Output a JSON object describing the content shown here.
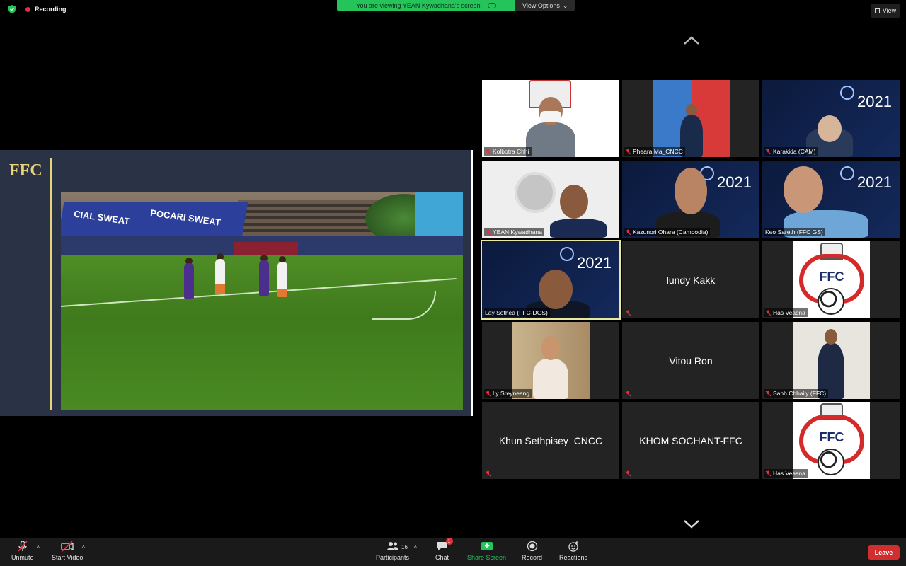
{
  "top": {
    "recording_label": "Recording",
    "viewing_banner": "You are viewing YEAN Kywadhana's screen",
    "view_options_label": "View Options",
    "view_label": "View"
  },
  "share": {
    "logo_text": "FFC",
    "video_ad_text_1": "CIAL SWEAT",
    "video_ad_text_2": "POCARI SWEAT"
  },
  "gallery": {
    "participants": [
      {
        "name": "Kolbotra Chhi"
      },
      {
        "name": "Pheara Ma_CNCC"
      },
      {
        "name": "Karakida (CAM)"
      },
      {
        "name": "YEAN Kywadhana"
      },
      {
        "name": "Kazunori Ohara (Cambodia)"
      },
      {
        "name": "Keo Sareth (FFC GS)"
      },
      {
        "name": "Lay Sothea (FFC-DGS)"
      },
      {
        "name": "lundy Kakk"
      },
      {
        "name": "Has Veasna"
      },
      {
        "name": "Ly Sreyneang"
      },
      {
        "name": "Vitou Ron"
      },
      {
        "name": "Sanh Chhaily (FFC)"
      },
      {
        "name": "Khun Sethpisey_CNCC"
      },
      {
        "name": "KHOM SOCHANT-FFC"
      },
      {
        "name": "Has Veasna"
      }
    ],
    "year_text": "2021",
    "crest_text": "FFC"
  },
  "toolbar": {
    "unmute": "Unmute",
    "start_video": "Start Video",
    "participants": "Participants",
    "participants_count": "16",
    "chat": "Chat",
    "chat_badge": "1",
    "share_screen": "Share Screen",
    "record": "Record",
    "reactions": "Reactions",
    "leave": "Leave"
  },
  "colors": {
    "banner_green": "#24c45a",
    "leave_red": "#d12f2f",
    "active_speaker": "#e9e8a0",
    "ffc_gold": "#e6d37a"
  }
}
